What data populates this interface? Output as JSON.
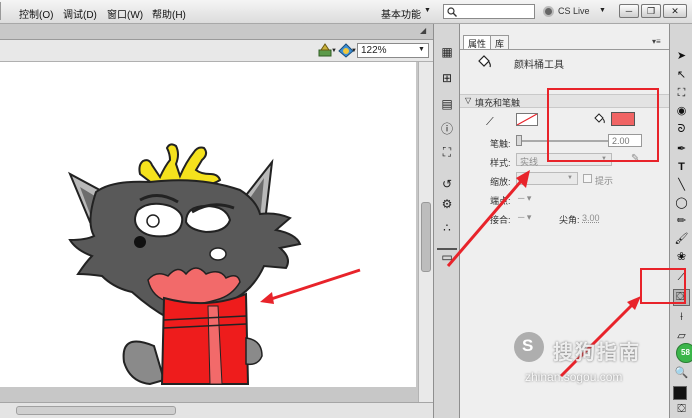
{
  "menubar": {
    "items": [
      "控制(O)",
      "调试(D)",
      "窗口(W)",
      "帮助(H)"
    ],
    "workspace": "基本功能",
    "search_icon": "search-icon",
    "cs_live": "CS Live"
  },
  "document": {
    "zoom": "122%"
  },
  "properties": {
    "tabs": [
      "属性",
      "库"
    ],
    "tool_name": "颜料桶工具",
    "section_title": "填充和笔触",
    "stroke_label": "笔触:",
    "stroke_value": "2.00",
    "style_label": "样式:",
    "style_value": "实线",
    "scale_label": "缩放:",
    "hint_label": "提示",
    "cap_label": "端点:",
    "join_label": "接合:",
    "miter_label": "尖角:",
    "miter_value": "3.00"
  },
  "colors": {
    "fill_color": "#f06464",
    "annotation_red": "#e8232a"
  },
  "watermark": {
    "brand": "搜狗指南",
    "url": "zhinan.sogou.com",
    "badge": "58"
  }
}
